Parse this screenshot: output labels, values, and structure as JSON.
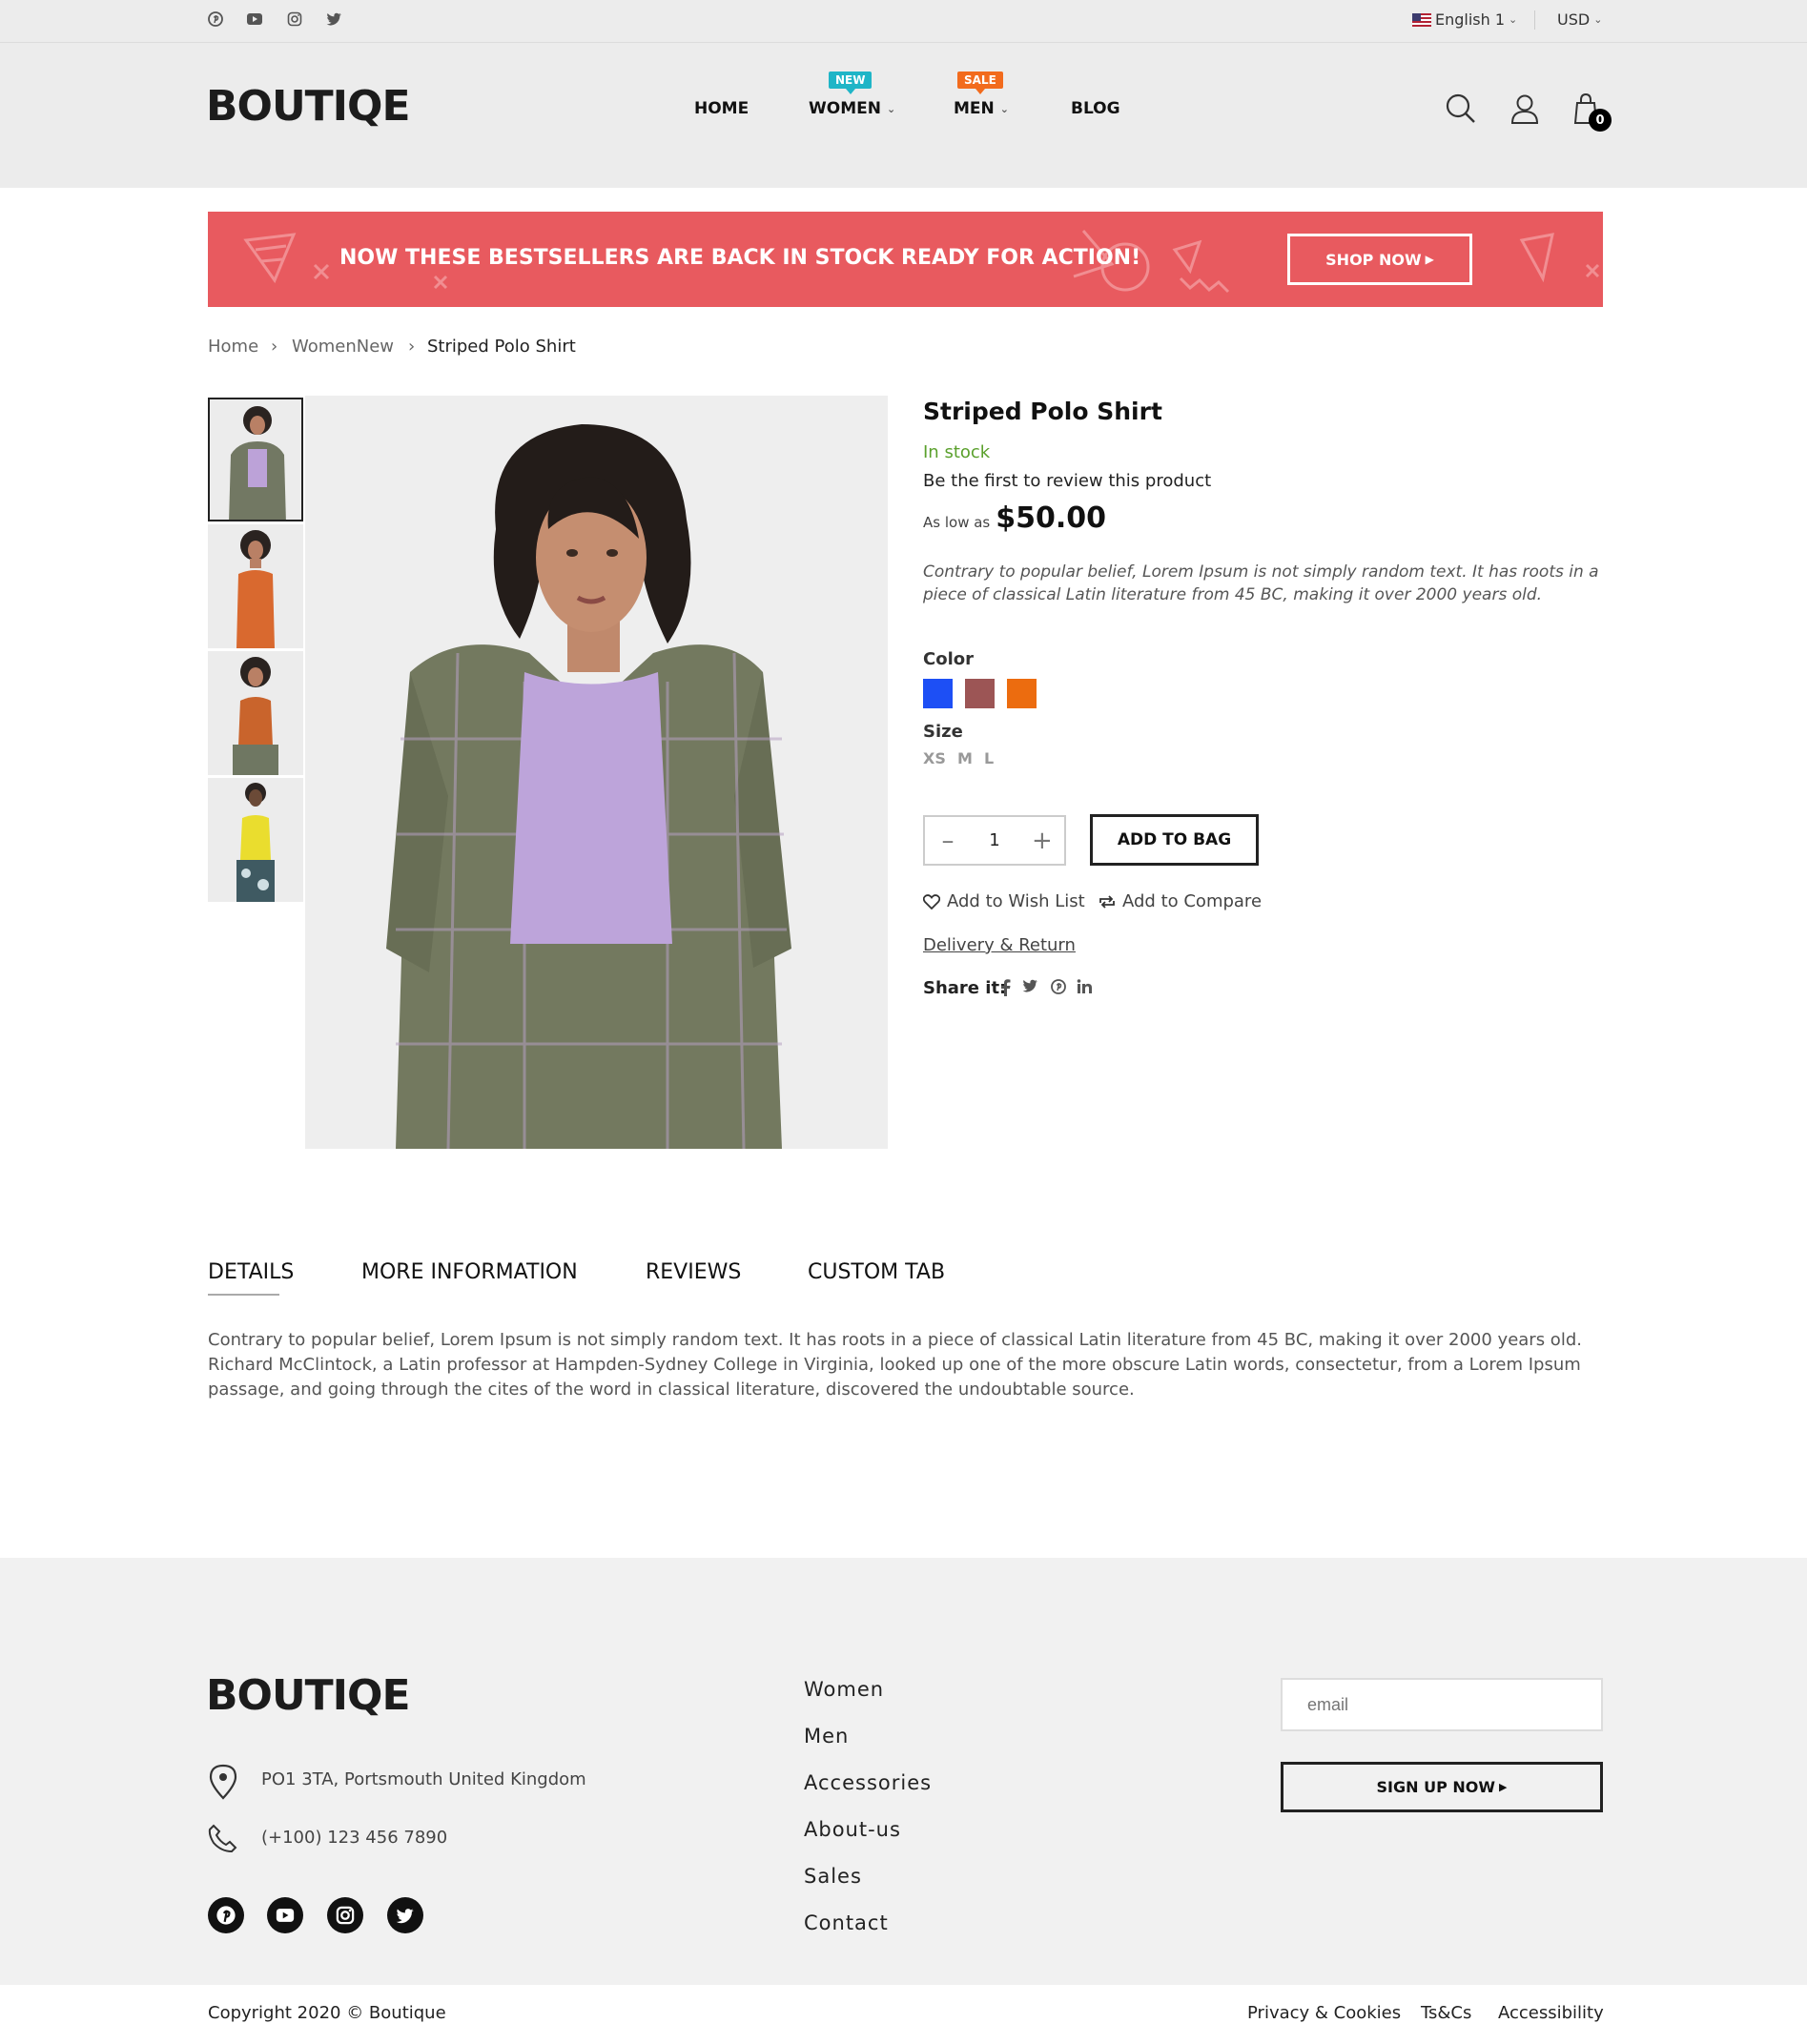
{
  "topbar": {
    "language": "English 1",
    "currency": "USD",
    "social_icons": [
      "pinterest-icon",
      "youtube-icon",
      "instagram-icon",
      "twitter-icon"
    ]
  },
  "header": {
    "logo": "BOUTIQE",
    "nav": [
      {
        "label": "HOME"
      },
      {
        "label": "WOMEN",
        "badge": "NEW",
        "badge_color": "#1fb5c7"
      },
      {
        "label": "MEN",
        "badge": "SALE",
        "badge_color": "#f26b1d"
      },
      {
        "label": "BLOG"
      }
    ],
    "cart_count": "0"
  },
  "banner": {
    "text": "NOW THESE BESTSELLERS ARE BACK IN STOCK READY FOR ACTION!",
    "button": "SHOP NOW",
    "color": "#e85a5f"
  },
  "breadcrumb": [
    "Home",
    "WomenNew",
    "Striped Polo Shirt"
  ],
  "product": {
    "title": "Striped Polo Shirt",
    "stock": "In stock",
    "review_prompt": "Be the first to review this product",
    "price_prefix": "As low as",
    "price": "$50.00",
    "short_description": "Contrary to popular belief, Lorem Ipsum is not simply random text. It has roots in a piece of classical Latin literature from 45 BC, making it over 2000 years old.",
    "color_label": "Color",
    "colors": [
      "#1d4ff5",
      "#9c5555",
      "#ec6c0f"
    ],
    "size_label": "Size",
    "sizes": [
      "XS",
      "M",
      "L"
    ],
    "quantity": "1",
    "add_to_bag": "ADD TO BAG",
    "wish_list": "Add to Wish List",
    "compare": "Add to Compare",
    "delivery": "Delivery & Return",
    "share_label": "Share it:"
  },
  "tabs": {
    "items": [
      "DETAILS",
      "MORE INFORMATION",
      "REVIEWS",
      "CUSTOM TAB"
    ],
    "active": "DETAILS",
    "details_text": "Contrary to popular belief, Lorem Ipsum is not simply random text. It has roots in a piece of classical Latin literature from 45 BC, making it over 2000 years old. Richard McClintock, a Latin professor at Hampden-Sydney College in Virginia, looked up one of the more obscure Latin words, consectetur, from a Lorem Ipsum passage, and going through the cites of the word in classical literature, discovered the undoubtable source."
  },
  "footer": {
    "logo": "BOUTIQE",
    "address": "PO1 3TA, Portsmouth United Kingdom",
    "phone": "(+100) 123 456 7890",
    "links": [
      "Women",
      "Men",
      "Accessories",
      "About-us",
      "Sales",
      "Contact"
    ],
    "email_placeholder": "email",
    "signup": "SIGN UP NOW",
    "copyright": "Copyright 2020 © Boutique",
    "legal": [
      "Privacy & Cookies",
      "Ts&Cs",
      "Accessibility"
    ]
  }
}
